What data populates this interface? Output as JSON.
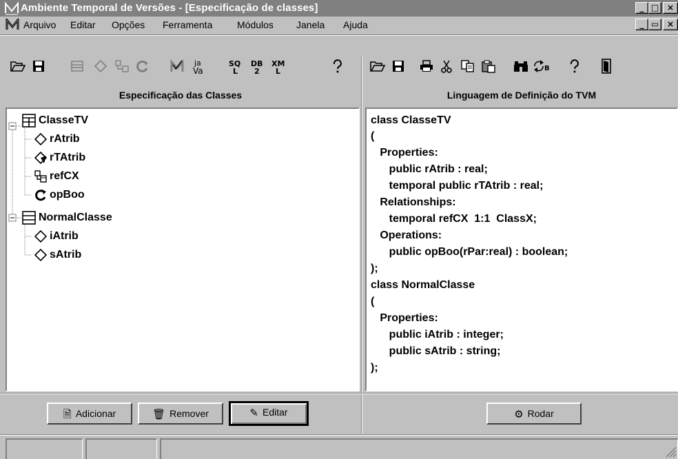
{
  "window": {
    "title": "Ambiente Temporal de Versões - [Especificação de classes]",
    "caption_buttons": [
      "_",
      "□",
      "×"
    ],
    "mdi_buttons": [
      "_",
      "▭",
      "×"
    ]
  },
  "menu": [
    {
      "label": "Arquivo"
    },
    {
      "label": "Editar"
    },
    {
      "label": "Opções"
    },
    {
      "label": "Ferramenta"
    },
    {
      "label": "Módulos"
    },
    {
      "label": "Janela"
    },
    {
      "label": "Ajuda"
    }
  ],
  "toolbar_left_icons": [
    "open-folder-icon",
    "save-disk-icon",
    "class-icon",
    "attribute-icon",
    "relationship-icon",
    "operation-icon",
    "check-icon",
    "ja-va-icon",
    "sql-icon",
    "db2-icon",
    "xml-icon",
    "help-icon"
  ],
  "toolbar_left_text": {
    "ja": "ja",
    "va": "Va",
    "sq": "SQ",
    "l": "L",
    "db": "DB",
    "two": "2",
    "xm": "XM",
    "xl": "L"
  },
  "toolbar_right_icons": [
    "open-folder-icon",
    "save-disk-icon",
    "print-icon",
    "cut-icon",
    "copy-icon",
    "paste-icon",
    "find-icon",
    "replace-icon",
    "help-icon",
    "exit-icon"
  ],
  "toolbar_right_text": {
    "replace_sub": "B"
  },
  "left_panel": {
    "header": "Especificação das Classes",
    "tree": [
      {
        "label": "ClasseTV",
        "icon": "class-temporal-icon",
        "level": 0,
        "expanded": true
      },
      {
        "label": "rAtrib",
        "icon": "attribute-icon",
        "level": 1
      },
      {
        "label": "rTAtrib",
        "icon": "temporal-attribute-icon",
        "level": 1
      },
      {
        "label": "refCX",
        "icon": "relationship-icon",
        "level": 1
      },
      {
        "label": "opBoo",
        "icon": "operation-icon",
        "level": 1
      },
      {
        "label": "NormalClasse",
        "icon": "class-icon",
        "level": 0,
        "expanded": true
      },
      {
        "label": "iAtrib",
        "icon": "attribute-icon",
        "level": 1
      },
      {
        "label": "sAtrib",
        "icon": "attribute-icon",
        "level": 1
      }
    ],
    "buttons": {
      "add": "Adicionar",
      "remove": "Remover",
      "edit": "Editar"
    }
  },
  "right_panel": {
    "header": "Linguagem de Definição do TVM",
    "code_lines": [
      "class ClasseTV",
      "(",
      "   Properties:",
      "      public rAtrib : real;",
      "      temporal public rTAtrib : real;",
      "   Relationships:",
      "      temporal refCX  1:1  ClassX;",
      "   Operations:",
      "      public opBoo(rPar:real) : boolean;",
      ");",
      "class NormalClasse",
      "(",
      "   Properties:",
      "      public iAtrib : integer;",
      "      public sAtrib : string;",
      ");"
    ],
    "buttons": {
      "run": "Rodar"
    }
  }
}
